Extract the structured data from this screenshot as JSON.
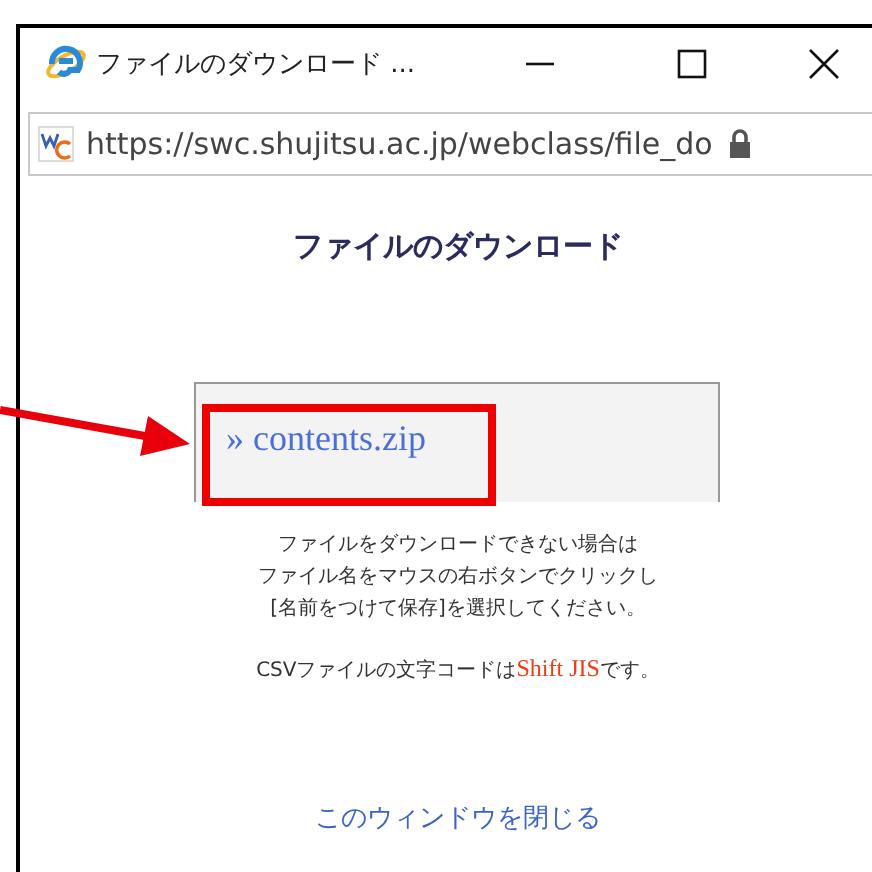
{
  "window": {
    "title": "ファイルのダウンロード ..."
  },
  "address_bar": {
    "url": "https://swc.shujitsu.ac.jp/webclass/file_do"
  },
  "page": {
    "heading": "ファイルのダウンロード",
    "file_link": "» contents.zip",
    "notice_lines": [
      "ファイルをダウンロードできない場合は",
      "ファイル名をマウスの右ボタンでクリックし",
      "[名前をつけて保存]を選択してください。"
    ],
    "encoding_note": "CSVファイルの文字コードは**Shift JIS**です。",
    "close_link": "このウィンドウを閉じる"
  }
}
